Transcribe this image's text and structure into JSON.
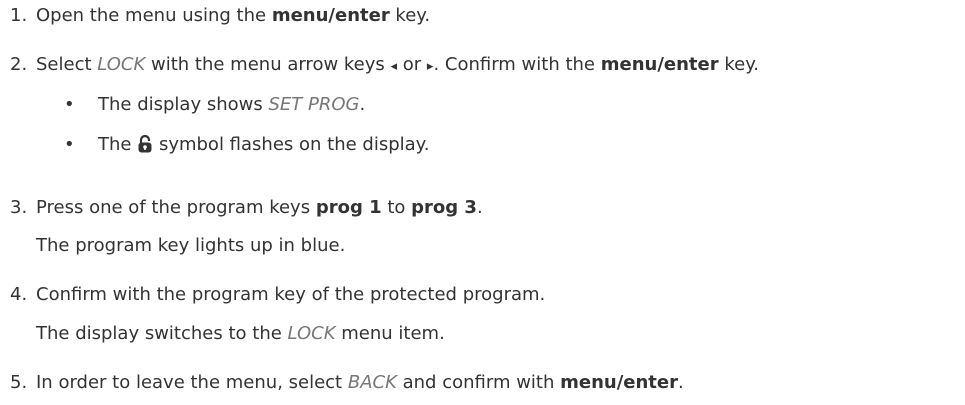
{
  "steps": [
    {
      "number": "1.",
      "parts": [
        "Open the menu using the ",
        "menu/enter",
        " key."
      ]
    },
    {
      "number": "2.",
      "parts": [
        "Select ",
        "LOCK",
        " with the menu arrow keys ",
        "◂",
        " or ",
        "▸",
        ". Confirm with the ",
        "menu/enter",
        " key."
      ],
      "bullets": [
        {
          "parts": [
            "The display shows ",
            "SET PROG",
            "."
          ]
        },
        {
          "parts": [
            "The ",
            "symbol flashes on the display."
          ]
        }
      ]
    },
    {
      "number": "3.",
      "parts": [
        "Press one of the program keys ",
        "prog 1",
        " to ",
        "prog 3",
        "."
      ],
      "result": "The program key lights up in blue."
    },
    {
      "number": "4.",
      "parts": [
        "Confirm with the program key of the protected program."
      ],
      "result_parts": [
        "The display switches to the ",
        "LOCK",
        " menu item."
      ]
    },
    {
      "number": "5.",
      "parts": [
        "In order to leave the menu, select ",
        "BACK",
        " and confirm with ",
        "menu/enter",
        "."
      ]
    }
  ],
  "bullet_char": "•",
  "icons": {
    "lock": "unlock-icon"
  }
}
